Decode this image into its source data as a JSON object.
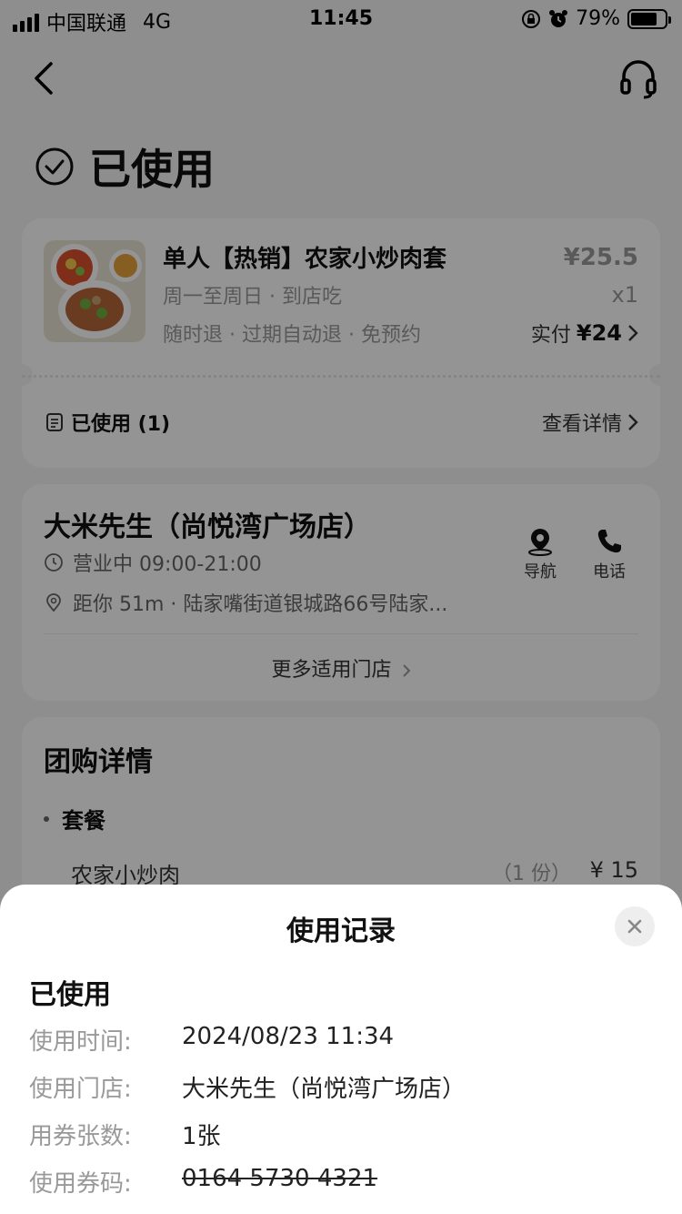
{
  "status_bar": {
    "carrier": "中国联通",
    "network": "4G",
    "time": "11:45",
    "battery": "79%",
    "battery_level": 0.79
  },
  "page": {
    "status": "已使用"
  },
  "order": {
    "product_name": "单人【热销】农家小炒肉套",
    "schedule": "周一至周日 · 到店吃",
    "tags": "随时退 · 过期自动退 · 免预约",
    "original_price": "¥25.5",
    "quantity": "x1",
    "paid_label": "实付",
    "paid_amount": "¥24",
    "used_count": "已使用 (1)",
    "view_details": "查看详情"
  },
  "store": {
    "name": "大米先生（尚悦湾广场店）",
    "hours": "营业中 09:00-21:00",
    "distance_address": "距你 51m ·  陆家嘴街道银城路66号陆家...",
    "nav_label": "导航",
    "call_label": "电话",
    "more_stores": "更多适用门店"
  },
  "deal_details": {
    "title": "团购详情",
    "combo_label": "套餐",
    "items": [
      {
        "name": "农家小炒肉",
        "portion": "（1 份）",
        "price": "¥ 15"
      }
    ]
  },
  "usage_sheet": {
    "title": "使用记录",
    "status": "已使用",
    "records": [
      {
        "label": "使用时间:",
        "value": "2024/08/23 11:34"
      },
      {
        "label": "使用门店:",
        "value": "大米先生（尚悦湾广场店）"
      },
      {
        "label": "用券张数:",
        "value": "1张"
      },
      {
        "label": "使用券码:",
        "value": "0164 5730 4321"
      }
    ]
  }
}
